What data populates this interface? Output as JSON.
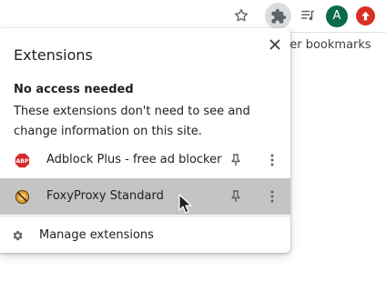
{
  "toolbar": {
    "icons": [
      "star-icon",
      "extensions-puzzle-icon",
      "media-control-icon",
      "avatar",
      "update-icon"
    ],
    "avatar_letter": "A"
  },
  "bookmarks_bar": {
    "other_bookmarks_label": "her bookmarks"
  },
  "extensions_popup": {
    "title": "Extensions",
    "section_heading": "No access needed",
    "section_description": "These extensions don't need to see and change information on this site.",
    "extensions": [
      {
        "name": "Adblock Plus - free ad blocker",
        "icon": "adblock-plus-icon",
        "highlighted": false
      },
      {
        "name": "FoxyProxy Standard",
        "icon": "foxyproxy-icon",
        "highlighted": true
      }
    ],
    "manage_label": "Manage extensions"
  },
  "colors": {
    "highlight_row": "#c4c4c4",
    "avatar_bg": "#0b6b4a",
    "update_badge": "#d93025",
    "adblock_red": "#d42a2a"
  }
}
